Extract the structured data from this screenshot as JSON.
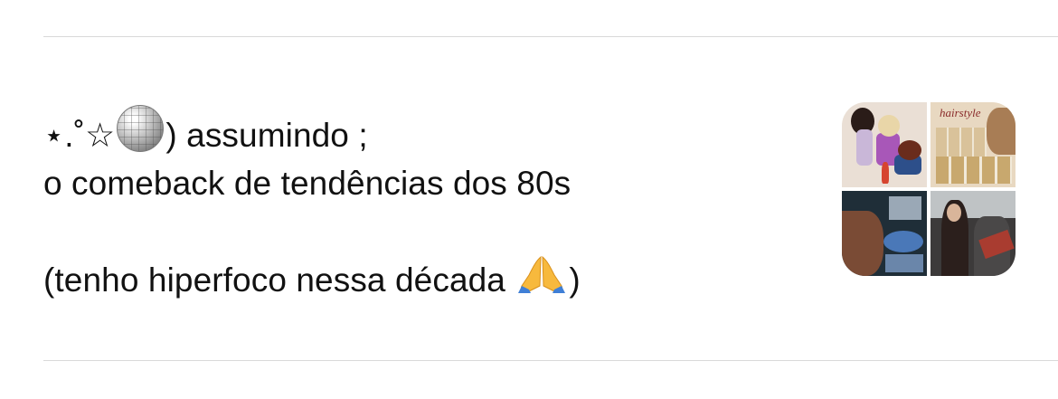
{
  "note": {
    "line1_prefix": "⋆.˚☆",
    "disco_ball_icon": "mirror-ball-emoji",
    "line1_suffix": ") assumindo ;",
    "line2": "o comeback de tendências dos 80s",
    "line3_prefix": "(tenho hiperfoco nessa década ",
    "praying_hands_icon": "folded-hands-emoji",
    "line3_suffix": ")"
  },
  "thumbnail": {
    "tile2_caption": "hairstyle"
  },
  "colors": {
    "divider": "#d9d9d9",
    "text": "#111111",
    "background": "#ffffff"
  }
}
